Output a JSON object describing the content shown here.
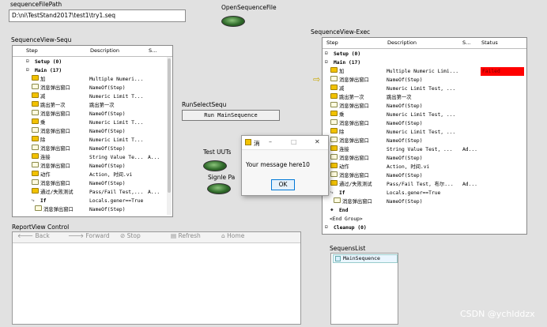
{
  "sequence_file_path": {
    "label": "sequenceFilePath",
    "value": "D:\\ni\\TestStand2017\\test1\\try1.seq"
  },
  "open_sequence_file": {
    "label": "OpenSequenceFile"
  },
  "run_select_sequ": {
    "label": "RunSelectSequ",
    "button": "Run MainSequence"
  },
  "test_uuts": {
    "label": "Test UUTs"
  },
  "single_pass": {
    "label": "Signle Pa"
  },
  "sequence_view": {
    "label": "SequenceView-Sequ",
    "columns": [
      "Step",
      "Description",
      "S..."
    ],
    "rows": [
      {
        "icon": "expand-icon",
        "step": "Setup (0)",
        "desc": "",
        "s": ""
      },
      {
        "icon": "expand-icon",
        "step": "Main (17)",
        "desc": "",
        "s": ""
      },
      {
        "icon": "step-icon",
        "step": "加",
        "desc": "Multiple Numeri...",
        "s": ""
      },
      {
        "icon": "message-icon",
        "step": "消息弹出窗口",
        "desc": "NameOf(Step)",
        "s": ""
      },
      {
        "icon": "step-icon",
        "step": "减",
        "desc": "Numeric Limit T...",
        "s": ""
      },
      {
        "icon": "step-icon",
        "step": "跳出第一次",
        "desc": "跳出第一次",
        "s": ""
      },
      {
        "icon": "message-icon",
        "step": "消息弹出窗口",
        "desc": "NameOf(Step)",
        "s": ""
      },
      {
        "icon": "step-icon",
        "step": "乘",
        "desc": "Numeric Limit T...",
        "s": ""
      },
      {
        "icon": "message-icon",
        "step": "消息弹出窗口",
        "desc": "NameOf(Step)",
        "s": ""
      },
      {
        "icon": "step-icon",
        "step": "除",
        "desc": "Numeric Limit T...",
        "s": ""
      },
      {
        "icon": "message-icon",
        "step": "消息弹出窗口",
        "desc": "NameOf(Step)",
        "s": ""
      },
      {
        "icon": "step-icon",
        "step": "连接",
        "desc": "String Value Te...",
        "s": "A..."
      },
      {
        "icon": "message-icon",
        "step": "消息弹出窗口",
        "desc": "NameOf(Step)",
        "s": ""
      },
      {
        "icon": "step-icon",
        "step": "动作",
        "desc": "Action,  时间.vi",
        "s": ""
      },
      {
        "icon": "message-icon",
        "step": "消息弹出窗口",
        "desc": "NameOf(Step)",
        "s": ""
      },
      {
        "icon": "step-icon",
        "step": "通过/失败测试",
        "desc": "Pass/Fail Test,...",
        "s": "A..."
      },
      {
        "icon": "if-icon",
        "step": "If",
        "desc": "Locals.gener==True",
        "s": ""
      },
      {
        "icon": "message-icon",
        "step": "消息弹出窗口",
        "desc": "NameOf(Step)",
        "s": ""
      }
    ]
  },
  "execution_view": {
    "label": "SequenceView-Exec",
    "columns": [
      "Step",
      "Description",
      "S...",
      "Status"
    ],
    "rows": [
      {
        "icon": "expand-icon",
        "step": "Setup (0)",
        "desc": "",
        "s": "",
        "status": ""
      },
      {
        "icon": "expand-icon",
        "step": "Main (17)",
        "desc": "",
        "s": "",
        "status": ""
      },
      {
        "icon": "step-icon",
        "step": "加",
        "desc": "Multiple Numeric Limi...",
        "s": "",
        "status": "Failed"
      },
      {
        "icon": "message-icon",
        "step": "消息弹出窗口",
        "desc": "NameOf(Step)",
        "s": "",
        "status": ""
      },
      {
        "icon": "step-icon",
        "step": "减",
        "desc": "Numeric Limit Test,  ...",
        "s": "",
        "status": ""
      },
      {
        "icon": "step-icon",
        "step": "跳出第一次",
        "desc": "跳出第一次",
        "s": "",
        "status": ""
      },
      {
        "icon": "message-icon",
        "step": "消息弹出窗口",
        "desc": "NameOf(Step)",
        "s": "",
        "status": ""
      },
      {
        "icon": "step-icon",
        "step": "乘",
        "desc": "Numeric Limit Test,  ...",
        "s": "",
        "status": ""
      },
      {
        "icon": "message-icon",
        "step": "消息弹出窗口",
        "desc": "NameOf(Step)",
        "s": "",
        "status": ""
      },
      {
        "icon": "step-icon",
        "step": "除",
        "desc": "Numeric Limit Test,  ...",
        "s": "",
        "status": ""
      },
      {
        "icon": "message-icon",
        "step": "消息弹出窗口",
        "desc": "NameOf(Step)",
        "s": "",
        "status": ""
      },
      {
        "icon": "step-icon",
        "step": "连接",
        "desc": "String Value Test,  ...",
        "s": "Ad...",
        "status": ""
      },
      {
        "icon": "message-icon",
        "step": "消息弹出窗口",
        "desc": "NameOf(Step)",
        "s": "",
        "status": ""
      },
      {
        "icon": "step-icon",
        "step": "动作",
        "desc": "Action,  时间.vi",
        "s": "",
        "status": ""
      },
      {
        "icon": "message-icon",
        "step": "消息弹出窗口",
        "desc": "NameOf(Step)",
        "s": "",
        "status": ""
      },
      {
        "icon": "step-icon",
        "step": "通过/失败测试",
        "desc": "Pass/Fail Test,  布尔...",
        "s": "Ad...",
        "status": ""
      },
      {
        "icon": "if-icon",
        "step": "If",
        "desc": "Locals.gener==True",
        "s": "",
        "status": ""
      },
      {
        "icon": "message-icon",
        "step": "消息弹出窗口",
        "desc": "NameOf(Step)",
        "s": "",
        "status": ""
      },
      {
        "icon": "end-icon",
        "step": "End",
        "desc": "",
        "s": "",
        "status": ""
      },
      {
        "icon": "none",
        "step": "<End Group>",
        "desc": "",
        "s": "",
        "status": ""
      },
      {
        "icon": "expand-icon",
        "step": "Cleanup (0)",
        "desc": "",
        "s": "",
        "status": ""
      }
    ],
    "failed_color": "#ff0000"
  },
  "report_view": {
    "label": "ReportView Control",
    "nav": [
      "Back",
      "Forward",
      "Stop",
      "Refresh",
      "Home"
    ]
  },
  "sequence_list": {
    "label": "SequensList",
    "items": [
      "MainSequence"
    ]
  },
  "dialog": {
    "title": "消",
    "message": "Your message here10",
    "ok": "OK",
    "controls": [
      "–",
      "□",
      "✕"
    ]
  },
  "watermark": "CSDN @ychlddzx"
}
